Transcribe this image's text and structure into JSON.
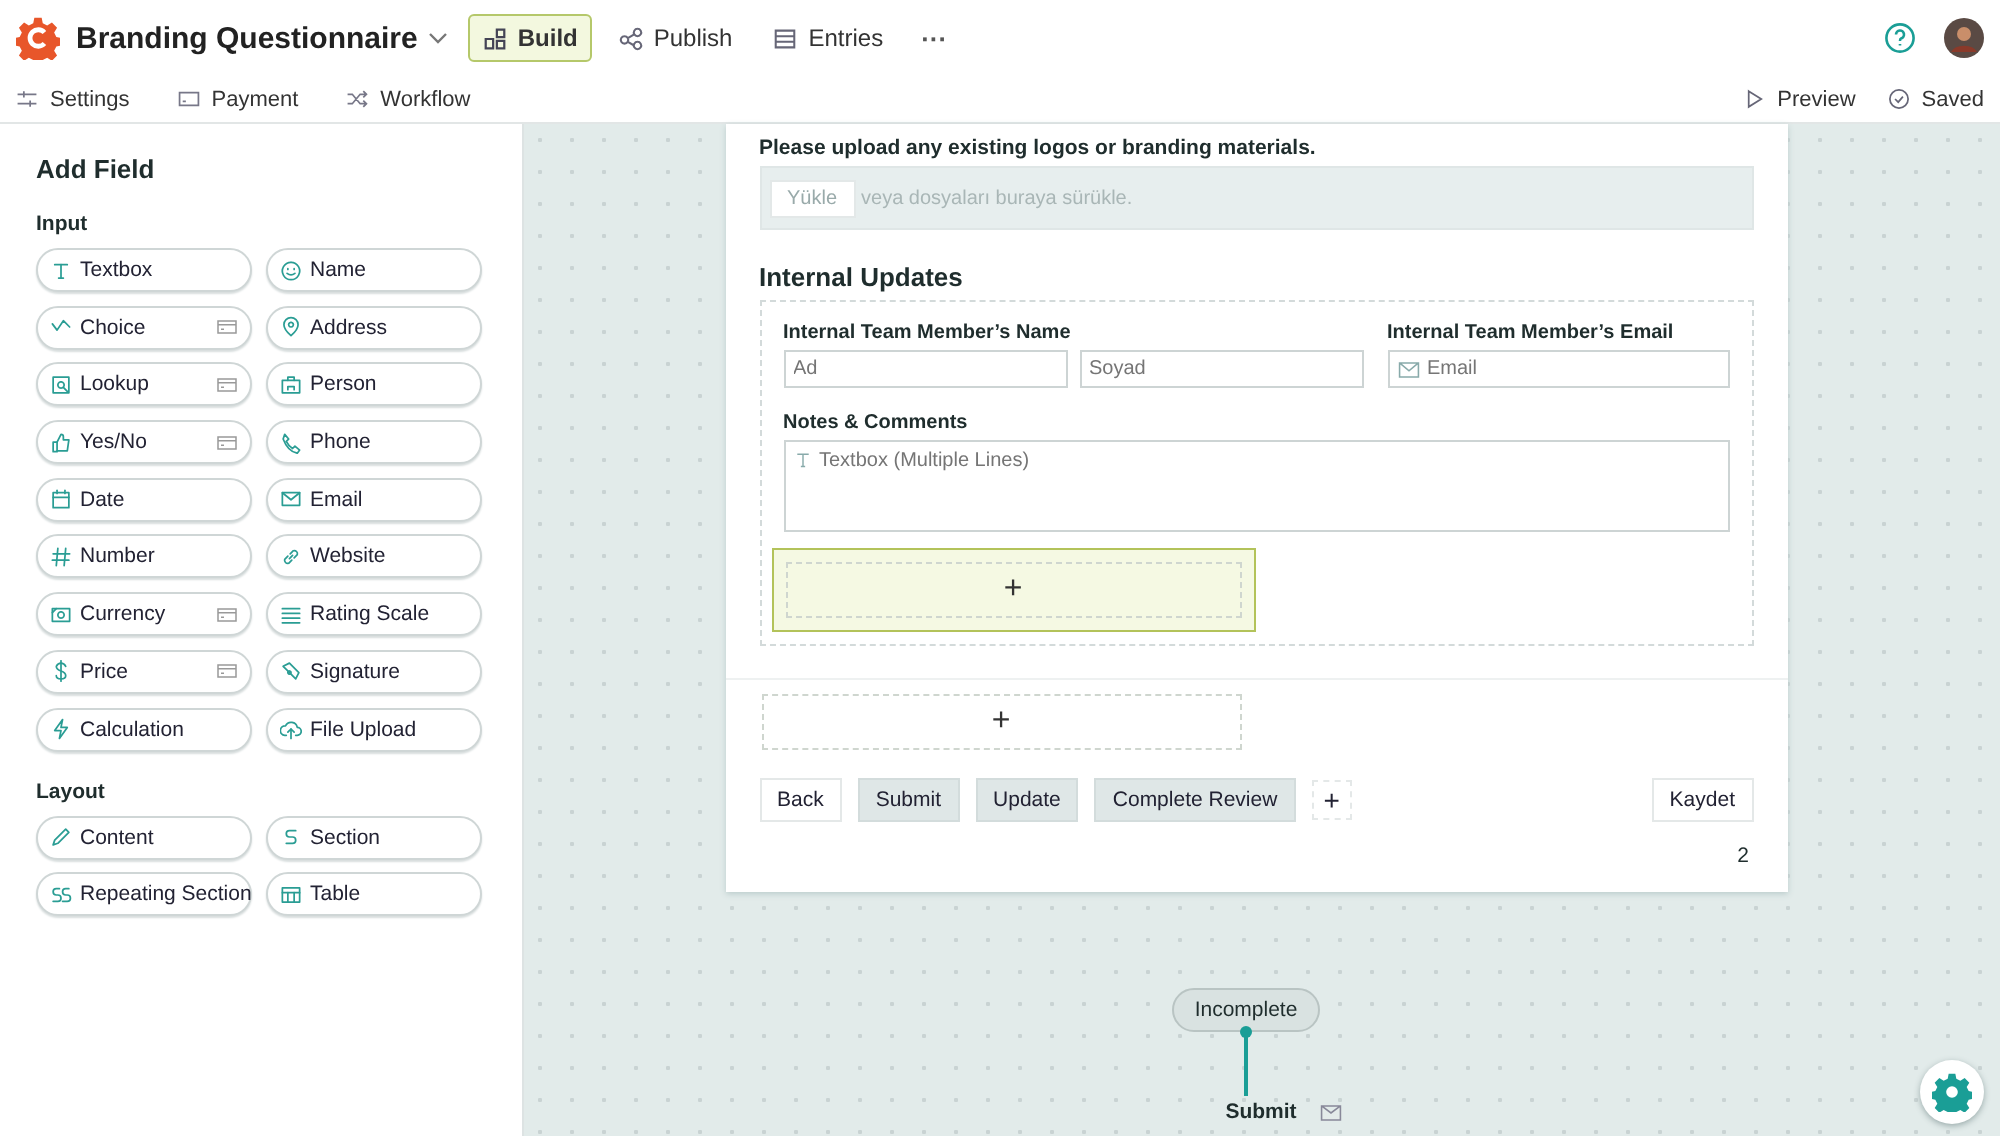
{
  "app": {
    "title": "Branding Questionnaire"
  },
  "tabs": [
    {
      "label": "Build",
      "selected": true
    },
    {
      "label": "Publish",
      "selected": false
    },
    {
      "label": "Entries",
      "selected": false
    }
  ],
  "more_menu": "···",
  "subnav": [
    "Settings",
    "Payment",
    "Workflow"
  ],
  "actions": {
    "preview": "Preview",
    "status": "Saved"
  },
  "sidebar": {
    "title": "Add Field",
    "groups": [
      {
        "title": "Input",
        "items": [
          {
            "label": "Textbox",
            "card_icon": false
          },
          {
            "label": "Name",
            "card_icon": false
          },
          {
            "label": "Choice",
            "card_icon": true
          },
          {
            "label": "Address",
            "card_icon": false
          },
          {
            "label": "Lookup",
            "card_icon": true
          },
          {
            "label": "Person",
            "card_icon": false
          },
          {
            "label": "Yes/No",
            "card_icon": true
          },
          {
            "label": "Phone",
            "card_icon": false
          },
          {
            "label": "Date",
            "card_icon": false
          },
          {
            "label": "Email",
            "card_icon": false
          },
          {
            "label": "Number",
            "card_icon": false
          },
          {
            "label": "Website",
            "card_icon": false
          },
          {
            "label": "Currency",
            "card_icon": true
          },
          {
            "label": "Rating Scale",
            "card_icon": false
          },
          {
            "label": "Price",
            "card_icon": true
          },
          {
            "label": "Signature",
            "card_icon": false
          },
          {
            "label": "Calculation",
            "card_icon": false
          },
          {
            "label": "File Upload",
            "card_icon": false
          }
        ]
      },
      {
        "title": "Layout",
        "items": [
          {
            "label": "Content",
            "card_icon": false
          },
          {
            "label": "Section",
            "card_icon": false
          },
          {
            "label": "Repeating Section",
            "card_icon": false
          },
          {
            "label": "Table",
            "card_icon": false
          }
        ]
      }
    ]
  },
  "form": {
    "upload": {
      "label": "Please upload any existing logos or branding materials.",
      "button": "Yükle",
      "hint": "veya dosyaları buraya sürükle."
    },
    "section": {
      "title": "Internal Updates",
      "name_label": "Internal Team Member’s Name",
      "first_placeholder": "Ad",
      "last_placeholder": "Soyad",
      "email_label": "Internal Team Member’s Email",
      "email_placeholder": "Email",
      "notes_label": "Notes & Comments",
      "notes_placeholder": "Textbox (Multiple Lines)",
      "add_cell": {
        "label": "+",
        "selected": true
      }
    },
    "add_row": {
      "label": "+",
      "selected": false
    },
    "buttons": [
      {
        "label": "Back",
        "kind": "plain"
      },
      {
        "label": "Submit",
        "kind": "action"
      },
      {
        "label": "Update",
        "kind": "action"
      },
      {
        "label": "Complete Review",
        "kind": "action"
      }
    ],
    "add_button": "+",
    "save_button": "Kaydet",
    "page_number": "2"
  },
  "workflow": {
    "status": "Incomplete",
    "step": "Submit"
  }
}
